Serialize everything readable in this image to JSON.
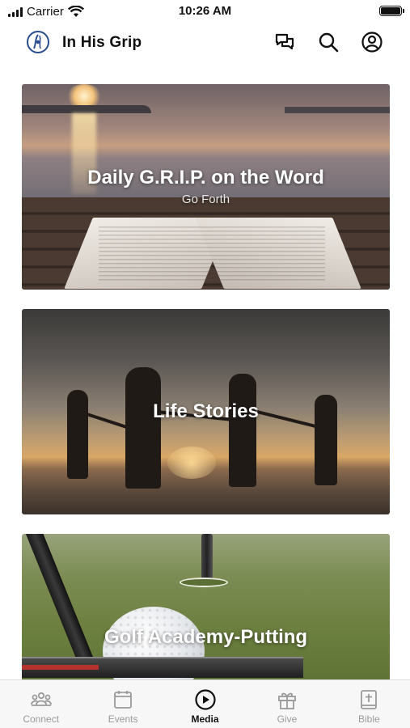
{
  "status_bar": {
    "carrier": "Carrier",
    "time": "10:26 AM"
  },
  "header": {
    "title": "In His Grip",
    "icons": [
      "logo-icon",
      "chat-icon",
      "search-icon",
      "profile-icon"
    ]
  },
  "cards": [
    {
      "title": "Daily G.R.I.P. on the Word",
      "subtitle": "Go Forth"
    },
    {
      "title": "Life Stories"
    },
    {
      "title": "Golf Academy-Putting"
    }
  ],
  "tabbar": {
    "items": [
      {
        "label": "Connect",
        "icon": "people-icon"
      },
      {
        "label": "Events",
        "icon": "calendar-icon"
      },
      {
        "label": "Media",
        "icon": "play-icon"
      },
      {
        "label": "Give",
        "icon": "gift-icon"
      },
      {
        "label": "Bible",
        "icon": "bible-icon"
      }
    ],
    "active": "Media"
  },
  "colors": {
    "text": "#111111",
    "inactive": "#9a9a9a",
    "tab_bg": "#f7f7f7"
  }
}
